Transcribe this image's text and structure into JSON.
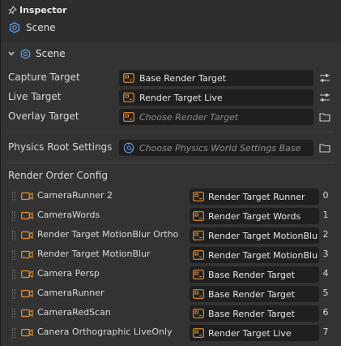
{
  "header": {
    "title": "Inspector",
    "object_name": "Scene"
  },
  "section": {
    "title": "Scene"
  },
  "properties": {
    "capture_target": {
      "label": "Capture Target",
      "value": "Base Render Target"
    },
    "live_target": {
      "label": "Live Target",
      "value": "Render Target Live"
    },
    "overlay_target": {
      "label": "Overlay Target",
      "placeholder": "Choose Render Target"
    },
    "physics_root": {
      "label": "Physics Root Settings",
      "placeholder": "Choose Physics World Settings Base"
    }
  },
  "render_order": {
    "label": "Render Order Config",
    "items": [
      {
        "camera": "CameraRunner 2",
        "target": "Render Target Runner",
        "index": "0"
      },
      {
        "camera": "CameraWords",
        "target": "Render Target Words",
        "index": "1"
      },
      {
        "camera": "Render Target MotionBlur Ortho",
        "target": "Render Target MotionBlu",
        "index": "2"
      },
      {
        "camera": "Render Target MotionBlur",
        "target": "Render Target MotionBlu",
        "index": "3"
      },
      {
        "camera": "Camera Persp",
        "target": "Base Render Target",
        "index": "4"
      },
      {
        "camera": "CameraRunner",
        "target": "Base Render Target",
        "index": "5"
      },
      {
        "camera": "CameraRedScan",
        "target": "Base Render Target",
        "index": "6"
      },
      {
        "camera": "Canera Orthographic LiveOnly",
        "target": "Render Target Live",
        "index": "7"
      }
    ]
  },
  "colors": {
    "accent_orange": "#e8902f",
    "scene_blue": "#5aa0e6",
    "field_bg": "#1f1f1f"
  },
  "icons": {
    "pin": "pin-icon",
    "scene": "scene-icon",
    "render_target": "render-target-icon",
    "physics": "physics-settings-icon",
    "camera": "camera-icon",
    "settings": "sliders-icon",
    "folder": "folder-icon",
    "collapse": "chevron-down-icon"
  }
}
